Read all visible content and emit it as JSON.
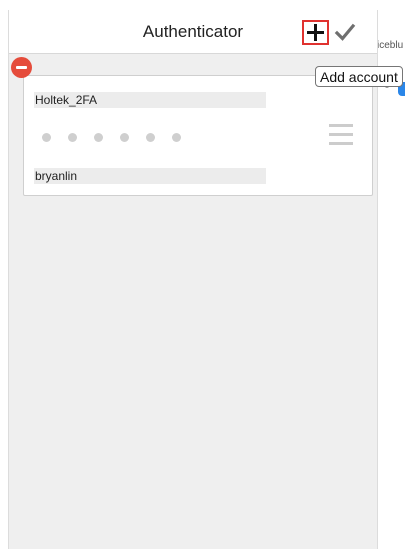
{
  "header": {
    "title": "Authenticator",
    "add_button_icon": "plus-icon",
    "done_button_icon": "check-icon"
  },
  "tooltip": {
    "text": "Add account"
  },
  "background": {
    "peek_text": "iceblu"
  },
  "accounts": [
    {
      "issuer": "Holtek_2FA",
      "code_hidden": "••••••",
      "account": "bryanlin"
    }
  ],
  "colors": {
    "highlight_border": "#e0322f",
    "remove_button": "#e54c3b",
    "panel_background": "#efefef"
  }
}
